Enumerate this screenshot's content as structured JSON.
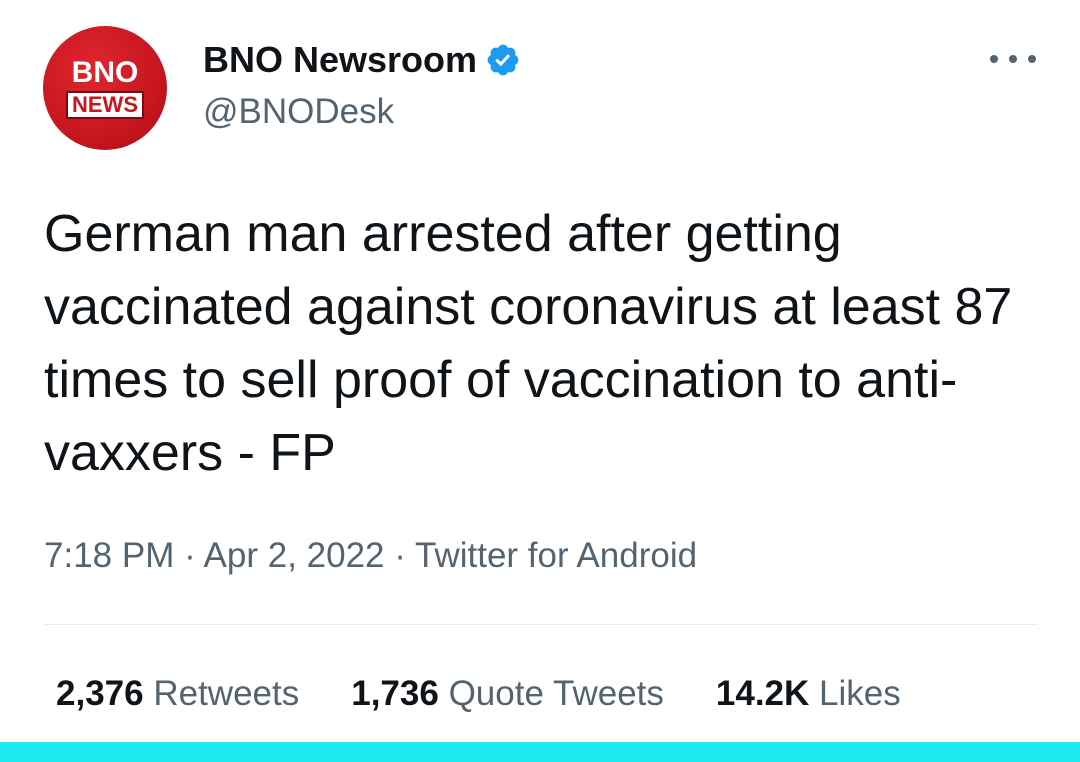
{
  "author": {
    "avatar_text_top": "BNO",
    "avatar_text_bottom": "NEWS",
    "display_name": "BNO Newsroom",
    "handle": "@BNODesk",
    "verified": true,
    "avatar_color": "#c8161f",
    "verified_color": "#1d9bf0"
  },
  "tweet": {
    "text": "German man arrested after getting vaccinated against coronavirus at least 87 times to sell proof of vaccination to anti-vaxxers - FP",
    "time": "7:18 PM",
    "date": "Apr 2, 2022",
    "source": "Twitter for Android",
    "separator": " · "
  },
  "stats": {
    "retweets_count": "2,376",
    "retweets_label": "Retweets",
    "quotes_count": "1,736",
    "quotes_label": "Quote Tweets",
    "likes_count": "14.2K",
    "likes_label": "Likes"
  },
  "icons": {
    "more": "more-options-icon",
    "verified": "verified-badge-icon"
  },
  "colors": {
    "text": "#0f1419",
    "secondary": "#536471",
    "bottom_bar": "#1de9f0"
  }
}
